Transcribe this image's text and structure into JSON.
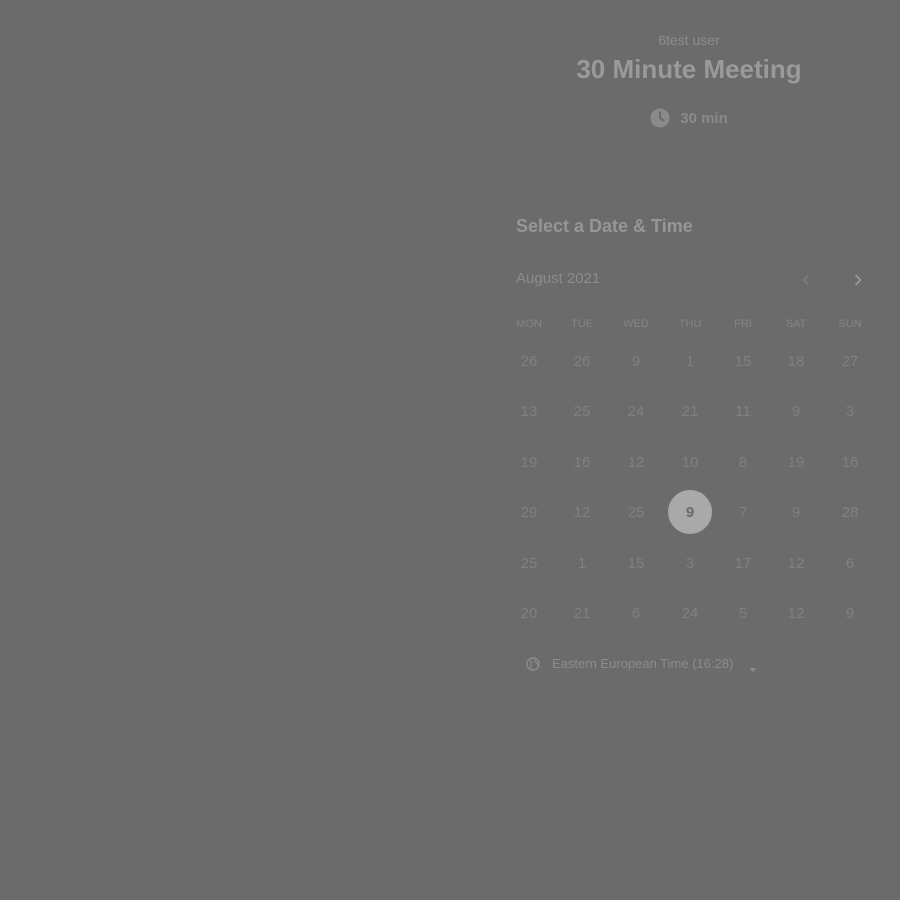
{
  "header": {
    "host_name": "6test user",
    "event_title": "30 Minute Meeting",
    "duration": "30 min",
    "duration_icon": "clock-icon"
  },
  "calendar": {
    "section_title": "Select a Date & Time",
    "month_label": "August 2021",
    "prev_icon": "chevron-left-icon",
    "next_icon": "chevron-right-icon",
    "weekdays": [
      "MON",
      "TUE",
      "WED",
      "THU",
      "FRI",
      "SAT",
      "SUN"
    ],
    "weeks": [
      [
        "26",
        "26",
        "9",
        "1",
        "15",
        "18",
        "27"
      ],
      [
        "13",
        "25",
        "24",
        "21",
        "11",
        "9",
        "3"
      ],
      [
        "19",
        "16",
        "12",
        "10",
        "8",
        "19",
        "16"
      ],
      [
        "29",
        "12",
        "25",
        "9",
        "7",
        "9",
        "28"
      ],
      [
        "25",
        "1",
        "15",
        "3",
        "17",
        "12",
        "6"
      ],
      [
        "20",
        "21",
        "6",
        "24",
        "5",
        "12",
        "9"
      ]
    ],
    "selected": {
      "week": 3,
      "day": 3
    }
  },
  "timezone": {
    "label": "Eastern European Time (16:28)",
    "icon": "globe-icon",
    "caret_icon": "caret-down-icon"
  }
}
